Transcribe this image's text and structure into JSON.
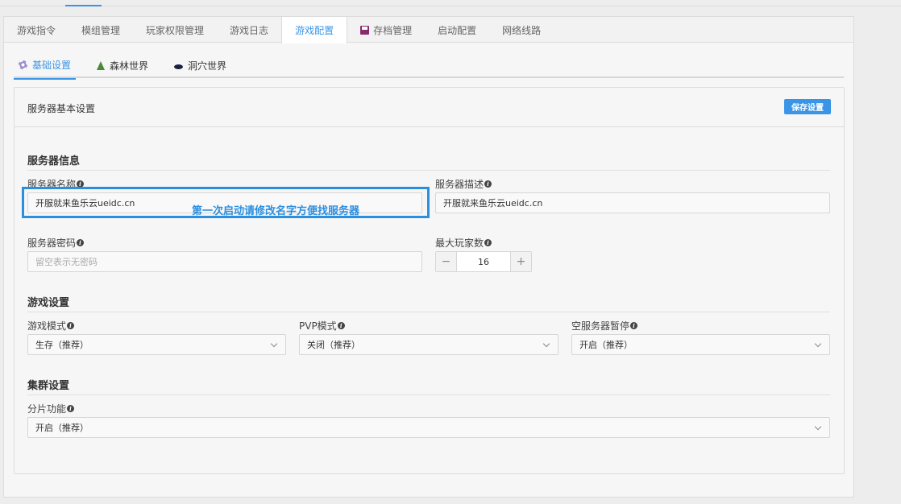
{
  "tabs": [
    {
      "label": "游戏指令",
      "active": false
    },
    {
      "label": "模组管理",
      "active": false
    },
    {
      "label": "玩家权限管理",
      "active": false
    },
    {
      "label": "游戏日志",
      "active": false
    },
    {
      "label": "游戏配置",
      "active": true
    },
    {
      "label": "存档管理",
      "active": false,
      "icon": "floppy-disk-icon"
    },
    {
      "label": "启动配置",
      "active": false
    },
    {
      "label": "网络线路",
      "active": false
    }
  ],
  "subtabs": [
    {
      "label": "基础设置",
      "active": true,
      "icon": "gear-icon"
    },
    {
      "label": "森林世界",
      "active": false,
      "icon": "tree-icon"
    },
    {
      "label": "洞穴世界",
      "active": false,
      "icon": "cave-icon"
    }
  ],
  "card": {
    "title": "服务器基本设置",
    "save_label": "保存设置"
  },
  "server_info": {
    "section_title": "服务器信息",
    "name_label": "服务器名称",
    "name_value": "开服就来鱼乐云ueidc.cn",
    "desc_label": "服务器描述",
    "desc_value": "开服就来鱼乐云ueidc.cn",
    "password_label": "服务器密码",
    "password_placeholder": "留空表示无密码",
    "max_players_label": "最大玩家数",
    "max_players_value": "16"
  },
  "game_settings": {
    "section_title": "游戏设置",
    "mode_label": "游戏模式",
    "mode_value": "生存（推荐）",
    "pvp_label": "PVP模式",
    "pvp_value": "关闭（推荐）",
    "pause_label": "空服务器暂停",
    "pause_value": "开启（推荐）"
  },
  "cluster_settings": {
    "section_title": "集群设置",
    "shard_label": "分片功能",
    "shard_value": "开启（推荐）"
  },
  "annotation": {
    "text": "第一次启动请修改名字方便找服务器"
  },
  "colors": {
    "accent": "#3a95e6",
    "annotation": "#2b8fe0"
  }
}
